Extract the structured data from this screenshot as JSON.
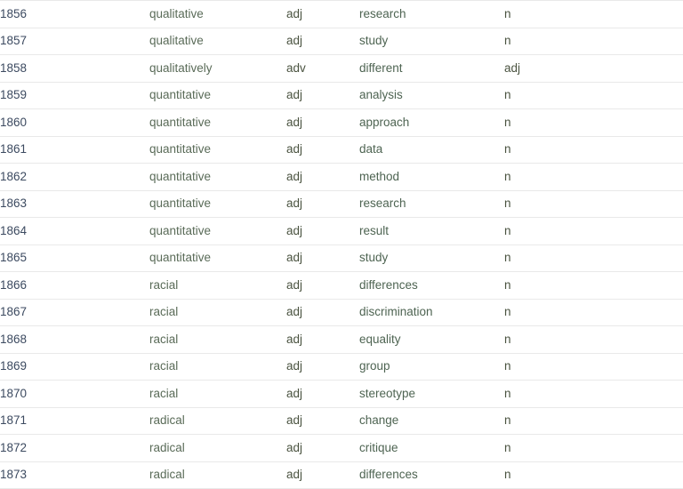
{
  "table": {
    "name": "collocation-list",
    "columns": [
      "index",
      "node_word",
      "node_pos",
      "collocate",
      "collocate_pos"
    ],
    "divider_color": "#e9e9e9",
    "index_color": "#3c4a60",
    "word_color": "#5a6b58",
    "pos_color": "#4a5340",
    "rows": [
      {
        "index": "1856",
        "node_word": "qualitative",
        "node_pos": "adj",
        "collocate": "research",
        "collocate_pos": "n"
      },
      {
        "index": "1857",
        "node_word": "qualitative",
        "node_pos": "adj",
        "collocate": "study",
        "collocate_pos": "n"
      },
      {
        "index": "1858",
        "node_word": "qualitatively",
        "node_pos": "adv",
        "collocate": "different",
        "collocate_pos": "adj"
      },
      {
        "index": "1859",
        "node_word": "quantitative",
        "node_pos": "adj",
        "collocate": "analysis",
        "collocate_pos": "n"
      },
      {
        "index": "1860",
        "node_word": "quantitative",
        "node_pos": "adj",
        "collocate": "approach",
        "collocate_pos": "n"
      },
      {
        "index": "1861",
        "node_word": "quantitative",
        "node_pos": "adj",
        "collocate": "data",
        "collocate_pos": "n"
      },
      {
        "index": "1862",
        "node_word": "quantitative",
        "node_pos": "adj",
        "collocate": "method",
        "collocate_pos": "n"
      },
      {
        "index": "1863",
        "node_word": "quantitative",
        "node_pos": "adj",
        "collocate": "research",
        "collocate_pos": "n"
      },
      {
        "index": "1864",
        "node_word": "quantitative",
        "node_pos": "adj",
        "collocate": "result",
        "collocate_pos": "n"
      },
      {
        "index": "1865",
        "node_word": "quantitative",
        "node_pos": "adj",
        "collocate": "study",
        "collocate_pos": "n"
      },
      {
        "index": "1866",
        "node_word": "racial",
        "node_pos": "adj",
        "collocate": "differences",
        "collocate_pos": "n"
      },
      {
        "index": "1867",
        "node_word": "racial",
        "node_pos": "adj",
        "collocate": "discrimination",
        "collocate_pos": "n"
      },
      {
        "index": "1868",
        "node_word": "racial",
        "node_pos": "adj",
        "collocate": "equality",
        "collocate_pos": "n"
      },
      {
        "index": "1869",
        "node_word": "racial",
        "node_pos": "adj",
        "collocate": "group",
        "collocate_pos": "n"
      },
      {
        "index": "1870",
        "node_word": "racial",
        "node_pos": "adj",
        "collocate": "stereotype",
        "collocate_pos": "n"
      },
      {
        "index": "1871",
        "node_word": "radical",
        "node_pos": "adj",
        "collocate": "change",
        "collocate_pos": "n"
      },
      {
        "index": "1872",
        "node_word": "radical",
        "node_pos": "adj",
        "collocate": "critique",
        "collocate_pos": "n"
      },
      {
        "index": "1873",
        "node_word": "radical",
        "node_pos": "adj",
        "collocate": "differences",
        "collocate_pos": "n"
      }
    ]
  }
}
